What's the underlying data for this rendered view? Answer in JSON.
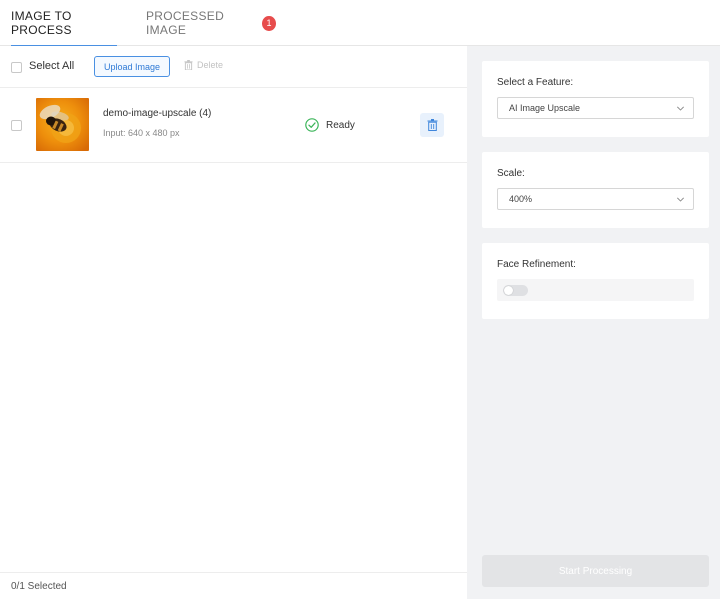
{
  "tabs": {
    "image_to_process": "IMAGE TO PROCESS",
    "processed_image": "PROCESSED IMAGE",
    "processed_count": "1"
  },
  "toolbar": {
    "select_all": "Select All",
    "upload": "Upload Image",
    "delete": "Delete"
  },
  "files": [
    {
      "name": "demo-image-upscale (4)",
      "info": "Input: 640 x 480 px",
      "status": "Ready"
    }
  ],
  "footer": {
    "selected": "0/1 Selected"
  },
  "settings": {
    "feature_label": "Select a Feature:",
    "feature_value": "AI Image Upscale",
    "scale_label": "Scale:",
    "scale_value": "400%",
    "face_label": "Face Refinement:",
    "face_enabled": false,
    "start_label": "Start Processing"
  },
  "colors": {
    "accent": "#4a90e2",
    "badge": "#e74c4c",
    "ready": "#3cb55a",
    "panel_bg": "#f1f2f4"
  }
}
